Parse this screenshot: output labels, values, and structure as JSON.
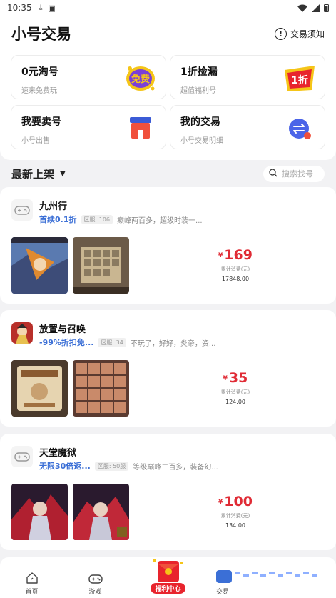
{
  "status": {
    "time": "10:35"
  },
  "header": {
    "title": "小号交易",
    "notice": "交易须知"
  },
  "cards": [
    {
      "title": "0元淘号",
      "sub": "速来免费玩",
      "badge": "免费"
    },
    {
      "title": "1折捡漏",
      "sub": "超值福利号",
      "badge": "1折"
    },
    {
      "title": "我要卖号",
      "sub": "小号出售"
    },
    {
      "title": "我的交易",
      "sub": "小号交易明细"
    }
  ],
  "sort": {
    "label": "最新上架",
    "search_placeholder": "搜索找号"
  },
  "listings": [
    {
      "name": "九州行",
      "promo": "首续0.1折",
      "server": "区服: 106",
      "desc": "巅峰两百多，超级时装一...",
      "price": "169",
      "spent_label": "累计消费(元)",
      "spent": "17848.00"
    },
    {
      "name": "放置与召唤",
      "promo": "-99%折扣免...",
      "server": "区服: 34",
      "desc": "不玩了，好好，炎帝，资...",
      "price": "35",
      "spent_label": "累计消费(元)",
      "spent": "124.00"
    },
    {
      "name": "天堂魔狱",
      "promo": "无限30倍返...",
      "server": "区服: 50服",
      "desc": "等级巅峰二百多，装备幻...",
      "price": "100",
      "spent_label": "累计消费(元)",
      "spent": "134.00"
    }
  ],
  "tabs": {
    "home": "首页",
    "games": "游戏",
    "welfare": "福利中心",
    "last": "交易"
  },
  "colors": {
    "accent": "#e02b35",
    "promo": "#3b6fd6"
  }
}
